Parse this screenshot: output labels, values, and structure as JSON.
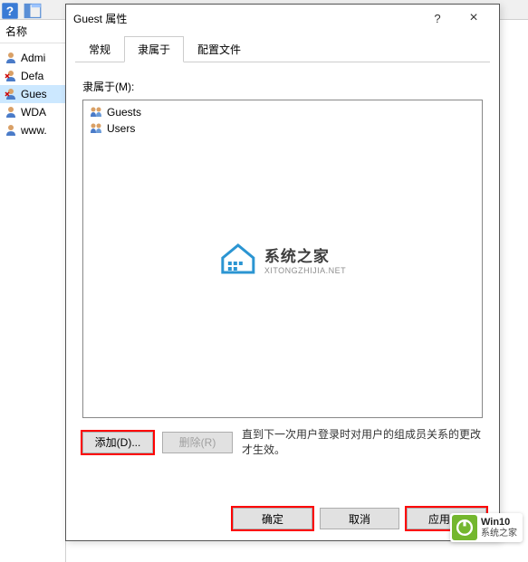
{
  "toolbar": {
    "icons": [
      "help-icon",
      "panel-icon"
    ]
  },
  "main_panel": {
    "column_header": "名称",
    "users": [
      {
        "label": "Admi",
        "selected": false,
        "disabled": false
      },
      {
        "label": "Defa",
        "selected": false,
        "disabled": true
      },
      {
        "label": "Gues",
        "selected": true,
        "disabled": true
      },
      {
        "label": "WDA",
        "selected": false,
        "disabled": false
      },
      {
        "label": "www.",
        "selected": false,
        "disabled": false
      }
    ]
  },
  "dialog": {
    "title": "Guest 属性",
    "help_symbol": "?",
    "close_symbol": "×",
    "tabs": [
      {
        "label": "常规",
        "active": false
      },
      {
        "label": "隶属于",
        "active": true
      },
      {
        "label": "配置文件",
        "active": false
      }
    ],
    "member_of_label": "隶属于(M):",
    "members": [
      {
        "label": "Guests"
      },
      {
        "label": "Users"
      }
    ],
    "add_button": "添加(D)...",
    "remove_button": "删除(R)",
    "note": "直到下一次用户登录时对用户的组成员关系的更改才生效。",
    "ok_button": "确定",
    "cancel_button": "取消",
    "apply_button": "应用(A)"
  },
  "watermark": {
    "title": "系统之家",
    "subtitle": "XITONGZHIJIA.NET"
  },
  "badge": {
    "title": "Win10",
    "subtitle": "系统之家"
  }
}
